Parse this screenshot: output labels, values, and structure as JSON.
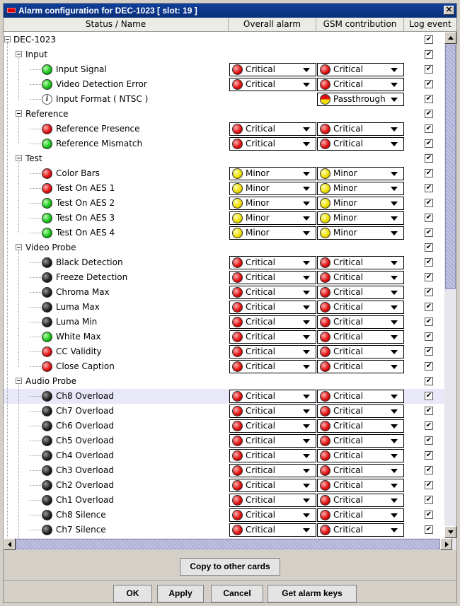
{
  "window": {
    "title": "Alarm configuration for DEC-1023 [ slot: 19 ]"
  },
  "columns": {
    "name": "Status / Name",
    "overall": "Overall alarm",
    "gsm": "GSM contribution",
    "log": "Log event"
  },
  "colors": {
    "critical": "#e01010",
    "minor": "#f0e000",
    "ok": "#19c019",
    "idle": "#222222",
    "selection": "#e8e8f8",
    "titlebar": "#0f3f9a"
  },
  "tree": {
    "root": "DEC-1023",
    "rows": [
      {
        "label": "DEC-1023",
        "level": 0,
        "type": "group",
        "log": true
      },
      {
        "label": "Input",
        "level": 1,
        "type": "group",
        "log": true
      },
      {
        "label": "Input Signal",
        "level": 2,
        "status": "green",
        "overall": "Critical",
        "gsm": "Critical",
        "log": true
      },
      {
        "label": "Video Detection Error",
        "level": 2,
        "status": "green",
        "overall": "Critical",
        "gsm": "Critical",
        "log": true
      },
      {
        "label": "Input Format ( NTSC )",
        "level": 2,
        "status": "info",
        "overall": null,
        "gsm": "Passthrough",
        "log": true
      },
      {
        "label": "Reference",
        "level": 1,
        "type": "group",
        "log": true
      },
      {
        "label": "Reference Presence",
        "level": 2,
        "status": "red",
        "overall": "Critical",
        "gsm": "Critical",
        "log": true
      },
      {
        "label": "Reference Mismatch",
        "level": 2,
        "status": "green",
        "overall": "Critical",
        "gsm": "Critical",
        "log": true
      },
      {
        "label": "Test",
        "level": 1,
        "type": "group",
        "log": true
      },
      {
        "label": "Color Bars",
        "level": 2,
        "status": "red",
        "overall": "Minor",
        "gsm": "Minor",
        "log": true
      },
      {
        "label": "Test On AES 1",
        "level": 2,
        "status": "red",
        "overall": "Minor",
        "gsm": "Minor",
        "log": true
      },
      {
        "label": "Test On AES 2",
        "level": 2,
        "status": "green",
        "overall": "Minor",
        "gsm": "Minor",
        "log": true
      },
      {
        "label": "Test On AES 3",
        "level": 2,
        "status": "green",
        "overall": "Minor",
        "gsm": "Minor",
        "log": true
      },
      {
        "label": "Test On AES 4",
        "level": 2,
        "status": "green",
        "overall": "Minor",
        "gsm": "Minor",
        "log": true
      },
      {
        "label": "Video Probe",
        "level": 1,
        "type": "group",
        "log": true
      },
      {
        "label": "Black Detection",
        "level": 2,
        "status": "black",
        "overall": "Critical",
        "gsm": "Critical",
        "log": true
      },
      {
        "label": "Freeze Detection",
        "level": 2,
        "status": "black",
        "overall": "Critical",
        "gsm": "Critical",
        "log": true
      },
      {
        "label": "Chroma Max",
        "level": 2,
        "status": "black",
        "overall": "Critical",
        "gsm": "Critical",
        "log": true
      },
      {
        "label": "Luma Max",
        "level": 2,
        "status": "black",
        "overall": "Critical",
        "gsm": "Critical",
        "log": true
      },
      {
        "label": "Luma Min",
        "level": 2,
        "status": "black",
        "overall": "Critical",
        "gsm": "Critical",
        "log": true
      },
      {
        "label": "White Max",
        "level": 2,
        "status": "green",
        "overall": "Critical",
        "gsm": "Critical",
        "log": true
      },
      {
        "label": "CC Validity",
        "level": 2,
        "status": "red",
        "overall": "Critical",
        "gsm": "Critical",
        "log": true
      },
      {
        "label": "Close Caption",
        "level": 2,
        "status": "red",
        "overall": "Critical",
        "gsm": "Critical",
        "log": true
      },
      {
        "label": "Audio Probe",
        "level": 1,
        "type": "group",
        "log": true
      },
      {
        "label": "Ch8 Overload",
        "level": 2,
        "status": "black",
        "overall": "Critical",
        "gsm": "Critical",
        "log": true,
        "selected": true
      },
      {
        "label": "Ch7 Overload",
        "level": 2,
        "status": "black",
        "overall": "Critical",
        "gsm": "Critical",
        "log": true
      },
      {
        "label": "Ch6 Overload",
        "level": 2,
        "status": "black",
        "overall": "Critical",
        "gsm": "Critical",
        "log": true
      },
      {
        "label": "Ch5 Overload",
        "level": 2,
        "status": "black",
        "overall": "Critical",
        "gsm": "Critical",
        "log": true
      },
      {
        "label": "Ch4 Overload",
        "level": 2,
        "status": "black",
        "overall": "Critical",
        "gsm": "Critical",
        "log": true
      },
      {
        "label": "Ch3 Overload",
        "level": 2,
        "status": "black",
        "overall": "Critical",
        "gsm": "Critical",
        "log": true
      },
      {
        "label": "Ch2 Overload",
        "level": 2,
        "status": "black",
        "overall": "Critical",
        "gsm": "Critical",
        "log": true
      },
      {
        "label": "Ch1 Overload",
        "level": 2,
        "status": "black",
        "overall": "Critical",
        "gsm": "Critical",
        "log": true
      },
      {
        "label": "Ch8 Silence",
        "level": 2,
        "status": "black",
        "overall": "Critical",
        "gsm": "Critical",
        "log": true
      },
      {
        "label": "Ch7 Silence",
        "level": 2,
        "status": "black",
        "overall": "Critical",
        "gsm": "Critical",
        "log": true
      }
    ]
  },
  "buttons": {
    "copy": "Copy to other cards",
    "ok": "OK",
    "apply": "Apply",
    "cancel": "Cancel",
    "keys": "Get alarm keys"
  }
}
